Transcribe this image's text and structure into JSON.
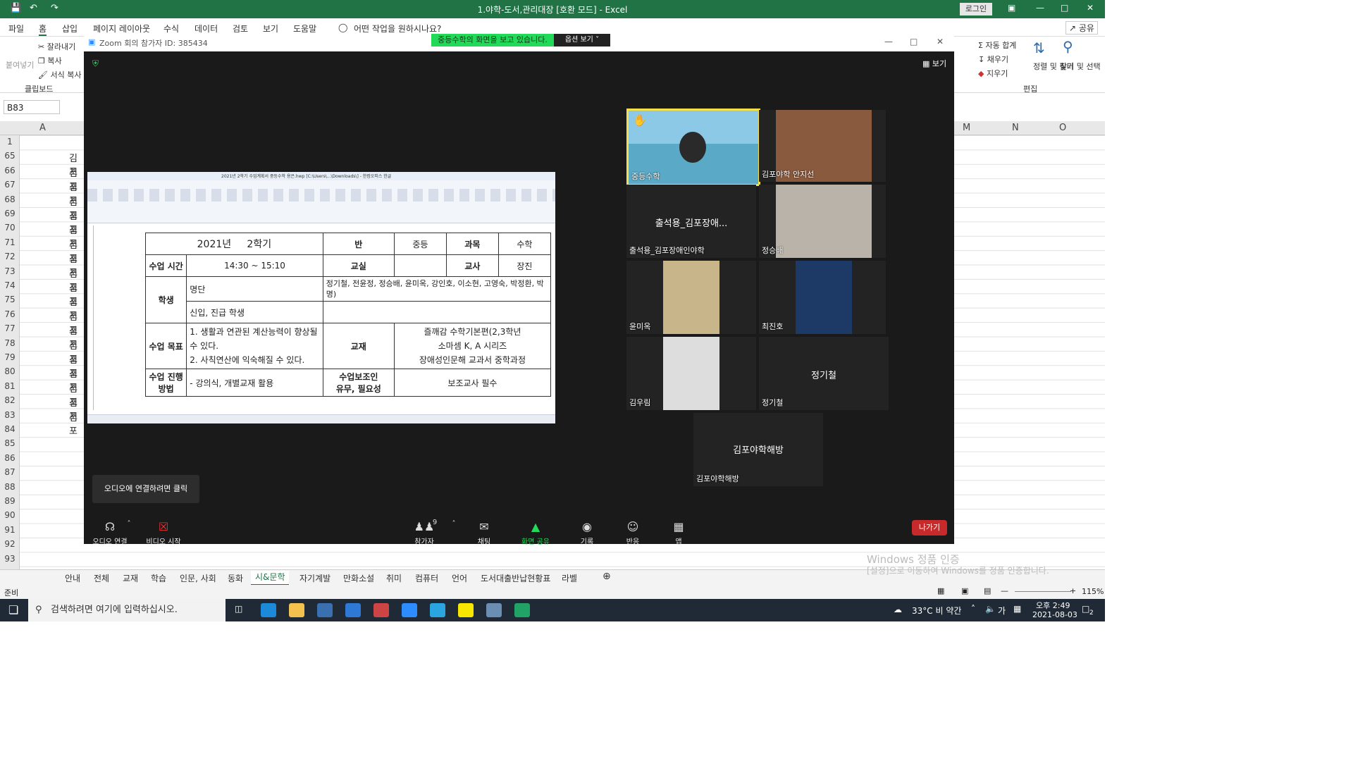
{
  "excel": {
    "title": "1.야학-도서,관리대장 [호환 모드] - Excel",
    "login": "로그인",
    "tabs": [
      "파일",
      "홈",
      "삽입",
      "페이지 레이아웃",
      "수식",
      "데이터",
      "검토",
      "보기",
      "도움말"
    ],
    "tell_me": "어떤 작업을 원하시나요?",
    "share": "공유",
    "clipboard": {
      "paste": "붙여넣기",
      "cut": "잘라내기",
      "copy": "복사",
      "format_painter": "서식 복사",
      "group": "클립보드"
    },
    "editing": {
      "autosum": "자동 합계",
      "fill": "채우기",
      "clear": "지우기",
      "sort_filter": "정렬 및 필터",
      "find_select": "찾기 및 선택",
      "group": "편집"
    },
    "namebox": "B83",
    "columns": [
      "A",
      "M",
      "N",
      "O"
    ],
    "rows": [
      "1",
      "65",
      "66",
      "67",
      "68",
      "69",
      "70",
      "71",
      "72",
      "73",
      "74",
      "75",
      "76",
      "77",
      "78",
      "79",
      "80",
      "81",
      "82",
      "83",
      "84",
      "85",
      "86",
      "87",
      "88",
      "89",
      "90",
      "91",
      "92",
      "93"
    ],
    "cell_a_text": "김포",
    "sheet_tabs": [
      "안내",
      "전체",
      "교재",
      "학습",
      "인문, 사회",
      "동화",
      "시&문학",
      "자기계발",
      "만화소설",
      "취미",
      "컴퓨터",
      "언어",
      "도서대출반납현황표",
      "라벨"
    ],
    "active_sheet": "시&문학",
    "status": "준비",
    "zoom": "115%",
    "activation_line1": "Windows 정품 인증",
    "activation_line2": "[설정]으로 이동하여 Windows를 정품 인증합니다."
  },
  "zoom": {
    "title": "Zoom 회의 참가자 ID: 385434",
    "share_banner": "중등수학의 화면을 보고 있습니다.",
    "view_options": "옵션 보기",
    "view_button": "보기",
    "audio_tip": "오디오에 연결하려면 클릭",
    "participants": [
      {
        "name": "중등수학"
      },
      {
        "name": "김포야학 안지선"
      },
      {
        "name": "출석용_김포장애인야학",
        "center": "출석용_김포장애..."
      },
      {
        "name": "정승배"
      },
      {
        "name": "윤미옥"
      },
      {
        "name": "최진호"
      },
      {
        "name": "김우림"
      },
      {
        "name": "정기철",
        "center": "정기철"
      },
      {
        "name": "김포야학해방",
        "center": "김포야학해방"
      }
    ],
    "toolbar": {
      "audio": "오디오 연결",
      "video": "비디오 시작",
      "participants": "참가자",
      "participants_count": "9",
      "chat": "채팅",
      "share": "화면 공유",
      "record": "기록",
      "reactions": "반응",
      "apps": "앱",
      "leave": "나가기"
    },
    "hwp": {
      "title": "2021년 2학기 수업계획서 중등수학 용은.hwp [C:\\Users\\...\\Downloads\\] - 한컴오피스 한글",
      "table": {
        "year": "2021년",
        "term": "2학기",
        "class_label": "반",
        "class_value": "중등",
        "subject_label": "과목",
        "subject_value": "수학",
        "time_label": "수업 시간",
        "time_value": "14:30 ~ 15:10",
        "room_label": "교실",
        "room_value": "",
        "teacher_label": "교사",
        "teacher_value": "장진",
        "student_label": "학생",
        "roster_label": "명단",
        "roster_value": "정기철, 전윤정, 정승배, 윤미옥, 강인호, 이소현, 고영숙, 박정환, 박",
        "roster_value2": "명)",
        "new_label": "신입, 진급 학생",
        "new_value": "",
        "goal_label": "수업 목표",
        "goal_value1": "1. 생활과 연관된 계산능력이 향상될",
        "goal_value2": "수 있다.",
        "goal_value3": "2. 사칙연산에 익숙해질 수 있다.",
        "textbook_label": "교재",
        "textbook_value1": "즐깨감 수학기본편(2,3학년",
        "textbook_value2": "소마셈 K, A 시리즈",
        "textbook_value3": "장애성인문해 교과서 중학과정",
        "method_label1": "수업 진행",
        "method_label2": "방법",
        "method_value": "- 강의식, 개별교재 활용",
        "assist_label1": "수업보조인",
        "assist_label2": "유무, 필요성",
        "assist_value": "보조교사 필수"
      }
    }
  },
  "taskbar": {
    "search_placeholder": "검색하려면 여기에 입력하십시오.",
    "weather": "33°C 비 약간",
    "ime": "가",
    "time": "오후 2:49",
    "date": "2021-08-03",
    "notif_count": "2"
  },
  "colors": {
    "excel_green": "#217346",
    "zoom_bg": "#1a1a1a",
    "share_green": "#23d959",
    "leave_red": "#c72a2a"
  }
}
